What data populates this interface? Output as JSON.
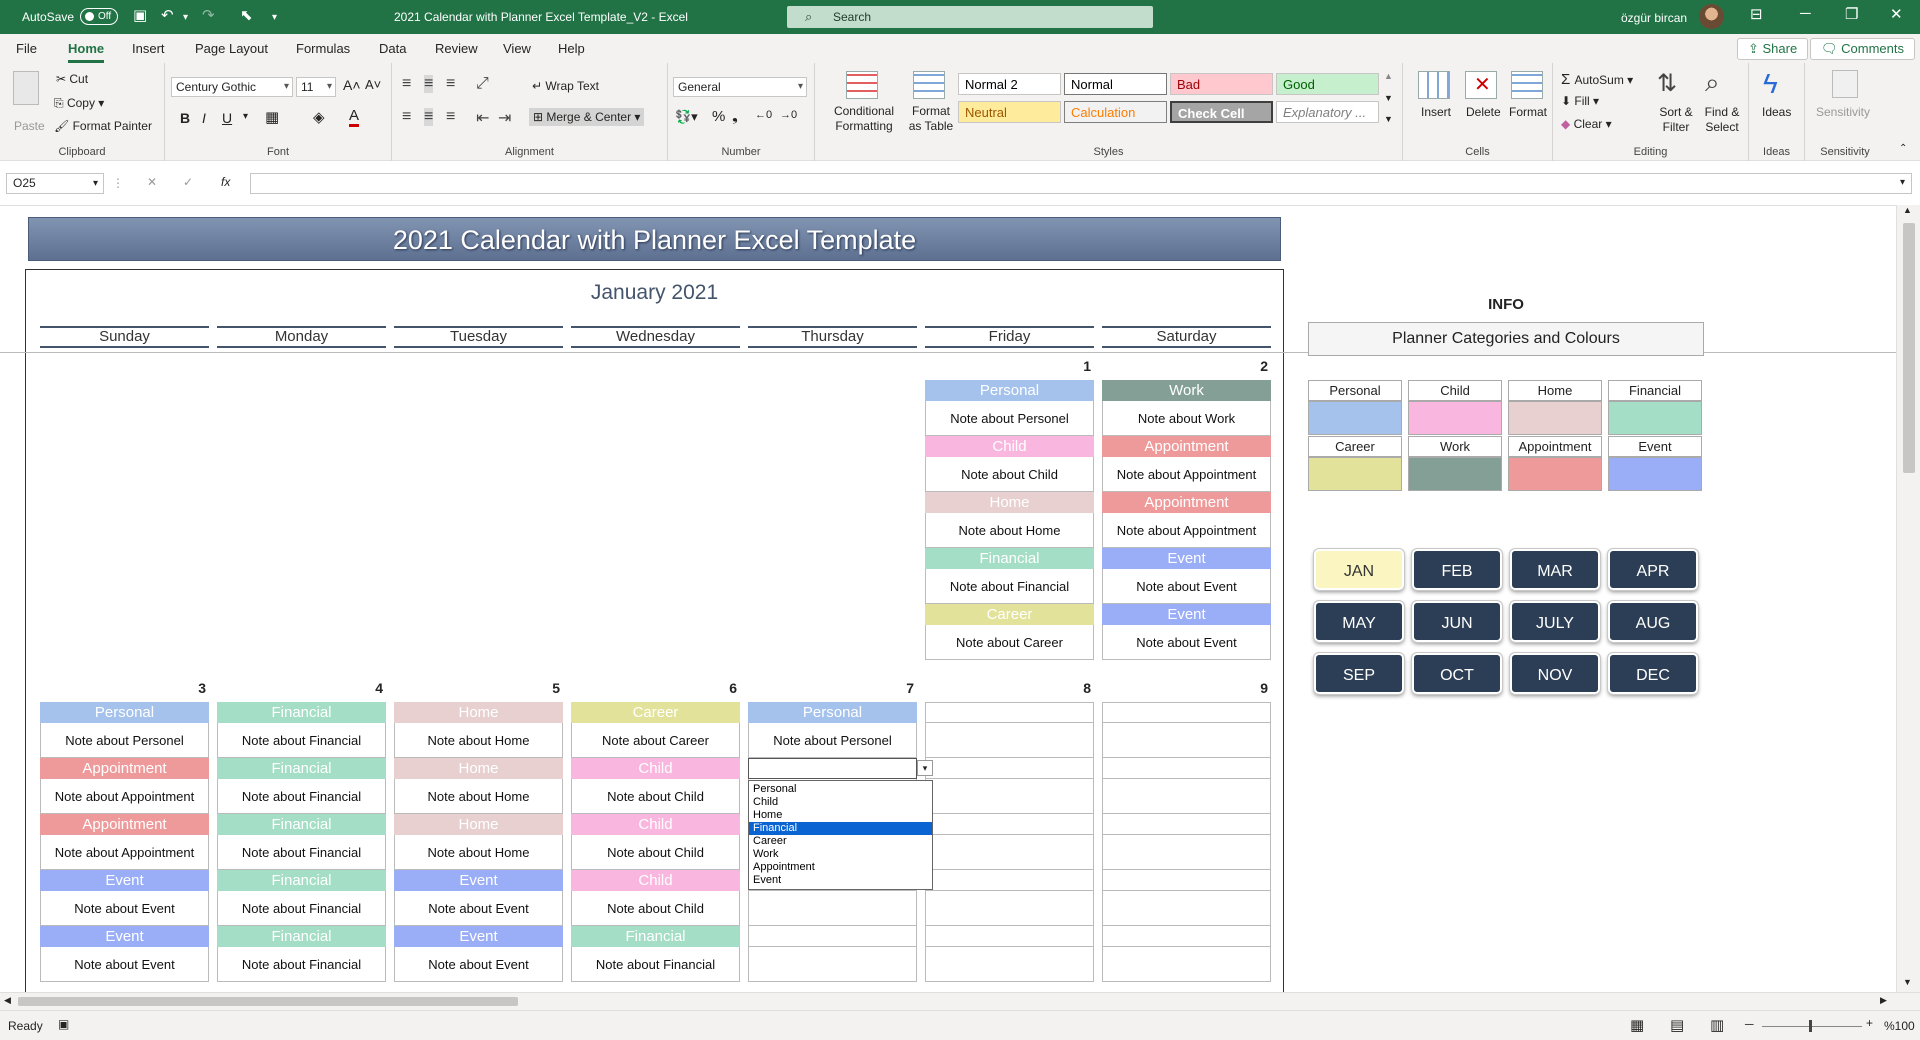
{
  "titlebar": {
    "autosave_label": "AutoSave",
    "autosave_state": "Off",
    "doc_title": "2021 Calendar with Planner Excel Template_V2  -  Excel",
    "search_placeholder": "Search",
    "user_name": "özgür bircan"
  },
  "menu": {
    "tabs": [
      "File",
      "Home",
      "Insert",
      "Page Layout",
      "Formulas",
      "Data",
      "Review",
      "View",
      "Help"
    ],
    "active": "Home",
    "share_label": "Share",
    "comments_label": "Comments"
  },
  "ribbon": {
    "clipboard": {
      "paste": "Paste",
      "cut": "Cut",
      "copy": "Copy",
      "format_painter": "Format Painter",
      "label": "Clipboard"
    },
    "font": {
      "name": "Century Gothic",
      "size": "11",
      "label": "Font"
    },
    "alignment": {
      "wrap": "Wrap Text",
      "merge": "Merge & Center",
      "label": "Alignment"
    },
    "number": {
      "format": "General",
      "label": "Number"
    },
    "styles": {
      "conditional": "Conditional Formatting",
      "format_table": "Format as Table",
      "label": "Styles",
      "cells": [
        {
          "name": "Normal 2",
          "bg": "#ffffff",
          "fg": "#000000"
        },
        {
          "name": "Normal",
          "bg": "#ffffff",
          "fg": "#000000"
        },
        {
          "name": "Bad",
          "bg": "#ffc7ce",
          "fg": "#9c0006"
        },
        {
          "name": "Good",
          "bg": "#c6efce",
          "fg": "#006100"
        },
        {
          "name": "Neutral",
          "bg": "#ffeb9c",
          "fg": "#9c5700"
        },
        {
          "name": "Calculation",
          "bg": "#f2f2f2",
          "fg": "#fa7d00"
        },
        {
          "name": "Check Cell",
          "bg": "#a5a5a5",
          "fg": "#ffffff"
        },
        {
          "name": "Explanatory ...",
          "bg": "#ffffff",
          "fg": "#7f7f7f"
        }
      ]
    },
    "cells": {
      "insert": "Insert",
      "delete": "Delete",
      "format": "Format",
      "label": "Cells"
    },
    "editing": {
      "autosum": "AutoSum",
      "fill": "Fill",
      "clear": "Clear",
      "sort": "Sort & Filter",
      "find": "Find & Select",
      "label": "Editing"
    },
    "ideas": {
      "btn": "Ideas",
      "label": "Ideas"
    },
    "sensitivity": {
      "btn": "Sensitivity",
      "label": "Sensitivity"
    }
  },
  "formula_bar": {
    "name_box": "O25",
    "fx": "fx",
    "formula": ""
  },
  "sheet": {
    "banner": "2021 Calendar with Planner Excel Template",
    "month_title": "January 2021",
    "day_names": [
      "Sunday",
      "Monday",
      "Tuesday",
      "Wednesday",
      "Thursday",
      "Friday",
      "Saturday"
    ],
    "category_colors": {
      "Personal": "#a4c2eb",
      "Child": "#f9b6de",
      "Home": "#e8d0d0",
      "Financial": "#a5dec6",
      "Career": "#e2e29a",
      "Work": "#84a096",
      "Appointment": "#ef9a9a",
      "Event": "#9aaef8"
    },
    "week1": {
      "days": [
        {
          "col": 5,
          "num": "1"
        },
        {
          "col": 6,
          "num": "2"
        }
      ],
      "entries": [
        [
          {
            "col": 5,
            "cat": "Personal",
            "note": "Note about Personel"
          },
          {
            "col": 6,
            "cat": "Work",
            "note": "Note about Work"
          }
        ],
        [
          {
            "col": 5,
            "cat": "Child",
            "note": "Note about Child"
          },
          {
            "col": 6,
            "cat": "Appointment",
            "note": "Note about Appointment"
          }
        ],
        [
          {
            "col": 5,
            "cat": "Home",
            "note": "Note about Home"
          },
          {
            "col": 6,
            "cat": "Appointment",
            "note": "Note about Appointment"
          }
        ],
        [
          {
            "col": 5,
            "cat": "Financial",
            "note": "Note about Financial"
          },
          {
            "col": 6,
            "cat": "Event",
            "note": "Note about Event"
          }
        ],
        [
          {
            "col": 5,
            "cat": "Career",
            "note": "Note about Career"
          },
          {
            "col": 6,
            "cat": "Event",
            "note": "Note about Event"
          }
        ]
      ]
    },
    "week2": {
      "days": [
        "3",
        "4",
        "5",
        "6",
        "7",
        "8",
        "9"
      ],
      "entries": [
        [
          {
            "cat": "Personal",
            "note": "Note about Personel"
          },
          {
            "cat": "Financial",
            "note": "Note about Financial"
          },
          {
            "cat": "Home",
            "note": "Note about Home"
          },
          {
            "cat": "Career",
            "note": "Note about Career"
          },
          {
            "cat": "Personal",
            "note": "Note about Personel"
          },
          null,
          null
        ],
        [
          {
            "cat": "Appointment",
            "note": "Note about Appointment"
          },
          {
            "cat": "Financial",
            "note": "Note about Financial"
          },
          {
            "cat": "Home",
            "note": "Note about Home"
          },
          {
            "cat": "Child",
            "note": "Note about Child"
          },
          null,
          null,
          null
        ],
        [
          {
            "cat": "Appointment",
            "note": "Note about Appointment"
          },
          {
            "cat": "Financial",
            "note": "Note about Financial"
          },
          {
            "cat": "Home",
            "note": "Note about Home"
          },
          {
            "cat": "Child",
            "note": "Note about Child"
          },
          null,
          null,
          null
        ],
        [
          {
            "cat": "Event",
            "note": "Note about Event"
          },
          {
            "cat": "Financial",
            "note": "Note about Financial"
          },
          {
            "cat": "Event",
            "note": "Note about Event"
          },
          {
            "cat": "Child",
            "note": "Note about Child"
          },
          null,
          null,
          null
        ],
        [
          {
            "cat": "Event",
            "note": "Note about Event"
          },
          {
            "cat": "Financial",
            "note": "Note about Financial"
          },
          {
            "cat": "Event",
            "note": "Note about Event"
          },
          {
            "cat": "Financial",
            "note": "Note about Financial"
          },
          null,
          null,
          null
        ]
      ]
    },
    "dropdown": {
      "options": [
        "Personal",
        "Child",
        "Home",
        "Financial",
        "Career",
        "Work",
        "Appointment",
        "Event"
      ],
      "highlighted": "Financial"
    },
    "info": {
      "title": "INFO",
      "subtitle": "Planner Categories and Colours",
      "legend": [
        "Personal",
        "Child",
        "Home",
        "Financial",
        "Career",
        "Work",
        "Appointment",
        "Event"
      ]
    },
    "months": [
      "JAN",
      "FEB",
      "MAR",
      "APR",
      "MAY",
      "JUN",
      "JULY",
      "AUG",
      "SEP",
      "OCT",
      "NOV",
      "DEC"
    ],
    "current_month": "JAN"
  },
  "status": {
    "ready": "Ready",
    "zoom": "%100"
  }
}
